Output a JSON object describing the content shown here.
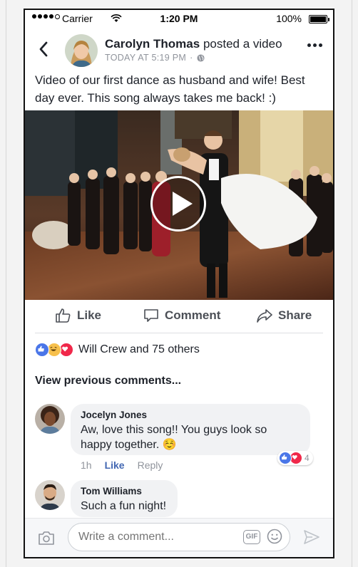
{
  "status_bar": {
    "carrier": "Carrier",
    "time": "1:20 PM",
    "battery": "100%"
  },
  "post": {
    "author": "Carolyn Thomas",
    "action": "posted a video",
    "timestamp": "TODAY AT 5:19 PM",
    "separator": "·",
    "text": "Video of our first dance as husband and wife! Best day ever. This song always takes me back! :)"
  },
  "actions": {
    "like": "Like",
    "comment": "Comment",
    "share": "Share"
  },
  "reactions": {
    "text": "Will Crew and 75 others"
  },
  "comments_section": {
    "view_previous": "View previous comments...",
    "comments": [
      {
        "author": "Jocelyn Jones",
        "text": "Aw, love this song!! You guys look so happy together. ☺️",
        "time": "1h",
        "like": "Like",
        "reply": "Reply",
        "reaction_count": "4"
      },
      {
        "author": "Tom Williams",
        "text": "Such a fun night!"
      }
    ]
  },
  "composer": {
    "placeholder": "Write a comment...",
    "gif_label": "GIF"
  },
  "colors": {
    "link_blue": "#4267b2",
    "like_blue": "#4a76e8",
    "love_red": "#f0284a",
    "haha_yellow": "#f7c04c"
  }
}
